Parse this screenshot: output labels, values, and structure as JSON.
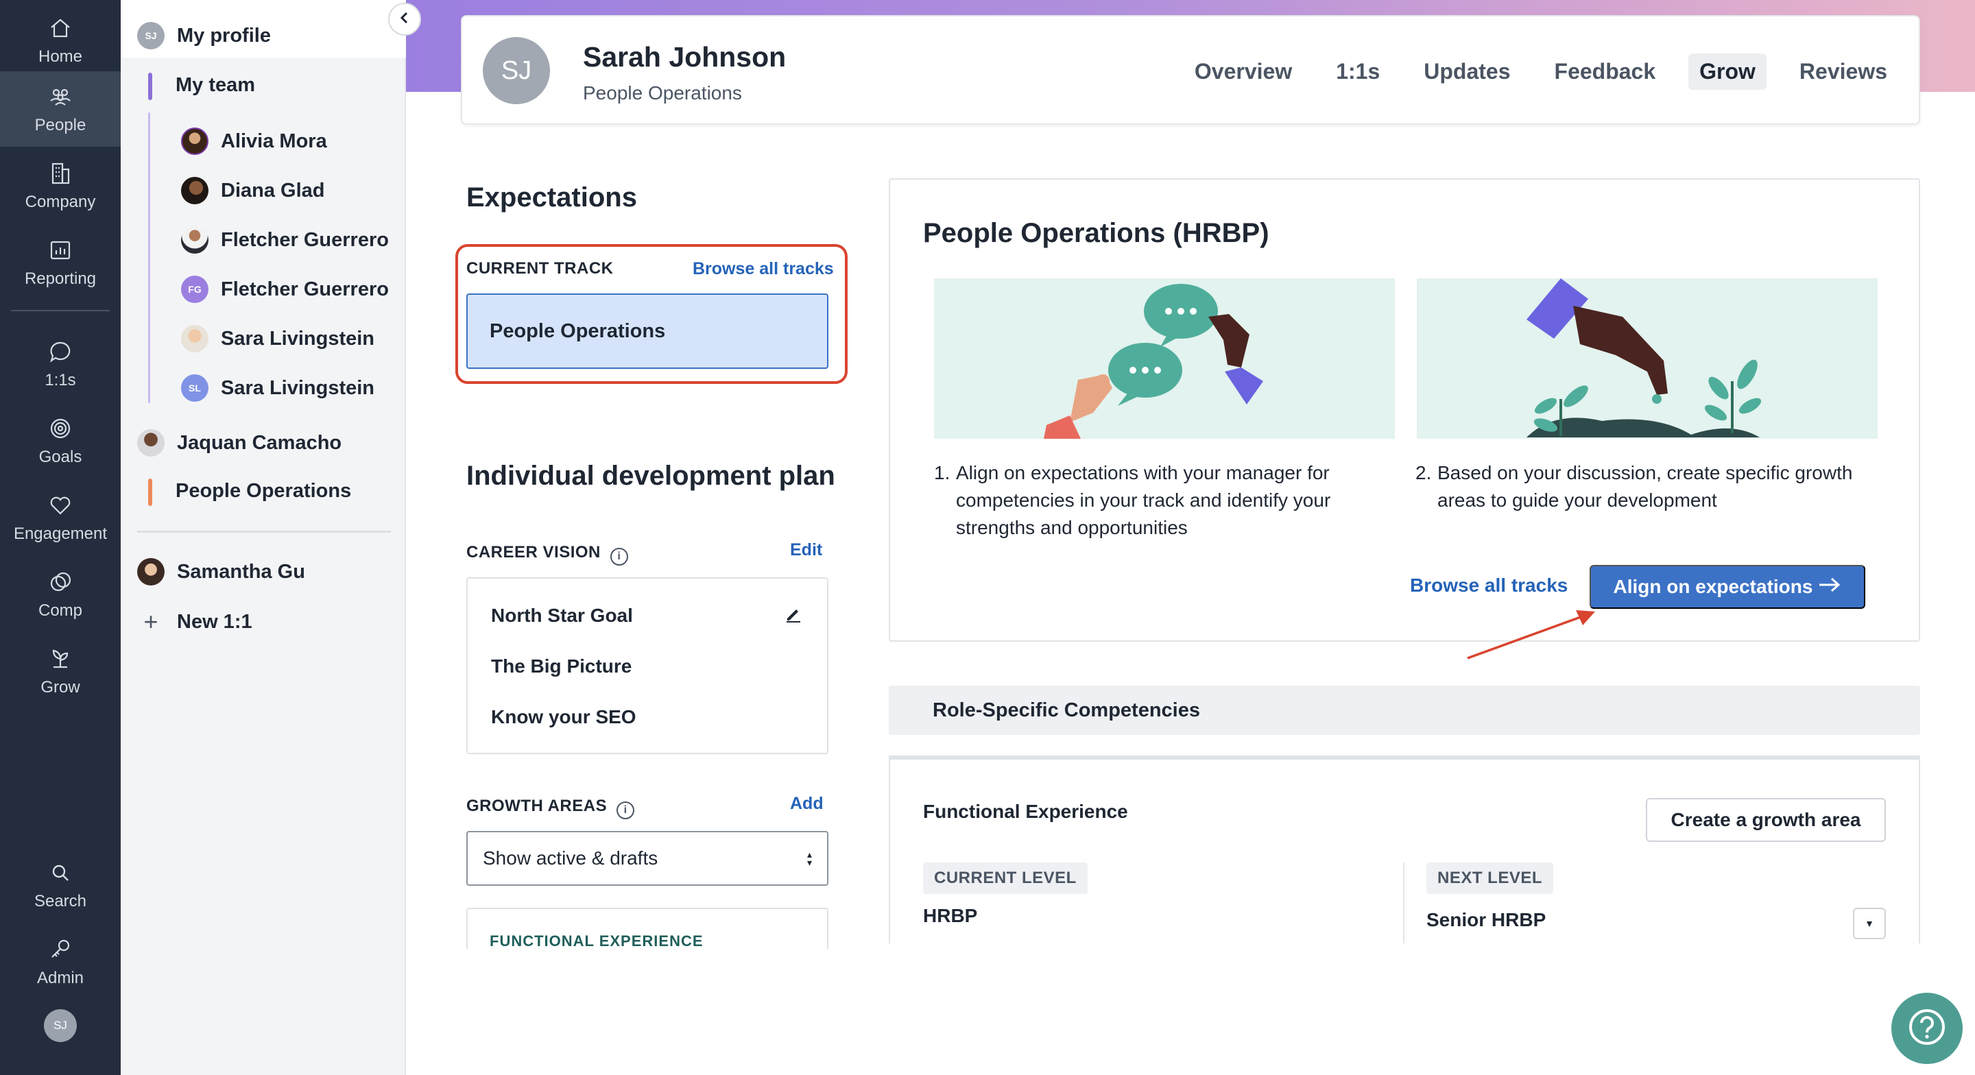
{
  "rail": {
    "items": [
      {
        "label": "Home",
        "icon": "home-icon"
      },
      {
        "label": "People",
        "icon": "people-icon"
      },
      {
        "label": "Company",
        "icon": "building-icon"
      },
      {
        "label": "Reporting",
        "icon": "chart-icon"
      },
      {
        "label": "1:1s",
        "icon": "chat-icon"
      },
      {
        "label": "Goals",
        "icon": "target-icon"
      },
      {
        "label": "Engagement",
        "icon": "heart-icon"
      },
      {
        "label": "Comp",
        "icon": "coins-icon"
      },
      {
        "label": "Grow",
        "icon": "sprout-icon"
      },
      {
        "label": "Search",
        "icon": "search-icon"
      },
      {
        "label": "Admin",
        "icon": "key-icon"
      }
    ],
    "active": "People",
    "user_initials": "SJ"
  },
  "panel": {
    "my_profile": {
      "label": "My profile",
      "initials": "SJ"
    },
    "my_team": "My team",
    "team_members": [
      {
        "name": "Alivia Mora",
        "avatar": "photo"
      },
      {
        "name": "Diana Glad",
        "avatar": "photo"
      },
      {
        "name": "Fletcher Guerrero",
        "avatar": "photo"
      },
      {
        "name": "Fletcher Guerrero",
        "avatar": "initials",
        "initials": "FG"
      },
      {
        "name": "Sara Livingstein",
        "avatar": "photo"
      },
      {
        "name": "Sara Livingstein",
        "avatar": "initials",
        "initials": "SL"
      }
    ],
    "manager": "Jaquan Camacho",
    "department": "People Operations",
    "other": "Samantha Gu",
    "new_one_on_one": "New 1:1"
  },
  "header": {
    "initials": "SJ",
    "name": "Sarah Johnson",
    "role": "People Operations",
    "tabs": [
      "Overview",
      "1:1s",
      "Updates",
      "Feedback",
      "Grow",
      "Reviews"
    ],
    "active_tab": "Grow"
  },
  "expectations": {
    "title": "Expectations",
    "current_track_label": "CURRENT TRACK",
    "browse_link": "Browse all tracks",
    "track_value": "People Operations"
  },
  "idp": {
    "title": "Individual development plan",
    "career_vision_label": "CAREER VISION",
    "edit_link": "Edit",
    "vision_items": [
      "North Star Goal",
      "The Big Picture",
      "Know your SEO"
    ],
    "growth_areas_label": "GROWTH AREAS",
    "add_link": "Add",
    "filter_value": "Show active & drafts",
    "functional_experience_label": "FUNCTIONAL EXPERIENCE"
  },
  "hrbp": {
    "title": "People Operations (HRBP)",
    "step1": "Align on expectations with your manager for competencies in your track and identify your strengths and opportunities",
    "step2": "Based on your discussion, create specific growth areas to guide your development",
    "step1_num": "1.",
    "step2_num": "2.",
    "browse_link": "Browse all tracks",
    "align_button": "Align on expectations"
  },
  "competencies": {
    "title": "Role-Specific Competencies",
    "functional_title": "Functional Experience",
    "create_button": "Create a growth area",
    "current_level_label": "CURRENT LEVEL",
    "current_level": "HRBP",
    "next_level_label": "NEXT LEVEL",
    "next_level": "Senior HRBP"
  },
  "colors": {
    "accent": "#3c72c6",
    "annotation_red": "#d9452f",
    "rail_bg": "#232d3d",
    "help_button": "#4e9d92"
  }
}
